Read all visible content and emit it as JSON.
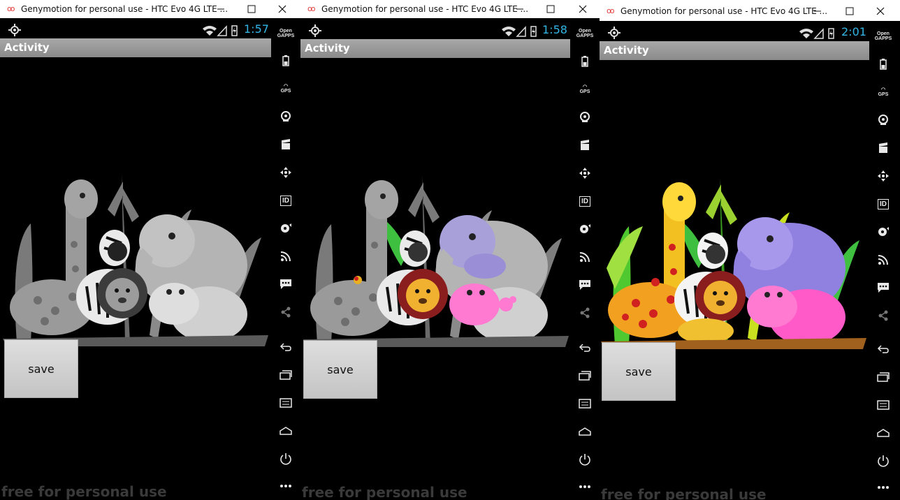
{
  "windows": [
    {
      "title": "Genymotion for personal use - HTC Evo 4G LTE ...",
      "status_time": "1:57",
      "action_bar_title": "Activity",
      "save_label": "save",
      "watermark": "free for personal use",
      "image_mode": "grayscale"
    },
    {
      "title": "Genymotion for personal use - HTC Evo 4G LTE ...",
      "status_time": "1:58",
      "action_bar_title": "Activity",
      "save_label": "save",
      "watermark": "free for personal use",
      "image_mode": "partially colored"
    },
    {
      "title": "Genymotion for personal use - HTC Evo 4G LTE ...",
      "status_time": "2:01",
      "action_bar_title": "Activity",
      "save_label": "save",
      "watermark": "free for personal use",
      "image_mode": "full color"
    }
  ],
  "sidebar_tools": [
    {
      "icon": "open-gapps-icon",
      "label": "Open GAPPS"
    },
    {
      "icon": "battery-icon",
      "label": ""
    },
    {
      "icon": "gps-icon",
      "label": "GPS"
    },
    {
      "icon": "camera-icon",
      "label": ""
    },
    {
      "icon": "media-clapper-icon",
      "label": ""
    },
    {
      "icon": "dpad-move-icon",
      "label": ""
    },
    {
      "icon": "device-id-icon",
      "label": "ID"
    },
    {
      "icon": "disk-io-icon",
      "label": ""
    },
    {
      "icon": "network-rss-icon",
      "label": ""
    },
    {
      "icon": "sms-icon",
      "label": ""
    },
    {
      "icon": "share-icon",
      "label": ""
    },
    {
      "icon": "back-icon",
      "label": ""
    },
    {
      "icon": "recent-apps-icon",
      "label": ""
    },
    {
      "icon": "menu-icon",
      "label": ""
    },
    {
      "icon": "home-icon",
      "label": ""
    },
    {
      "icon": "power-icon",
      "label": ""
    },
    {
      "icon": "more-icon",
      "label": ""
    }
  ],
  "colors": {
    "genymotion_logo": "#e23a3a",
    "status_time": "#33b5e5",
    "action_bar": "#9a9a9a",
    "background": "#000000"
  }
}
